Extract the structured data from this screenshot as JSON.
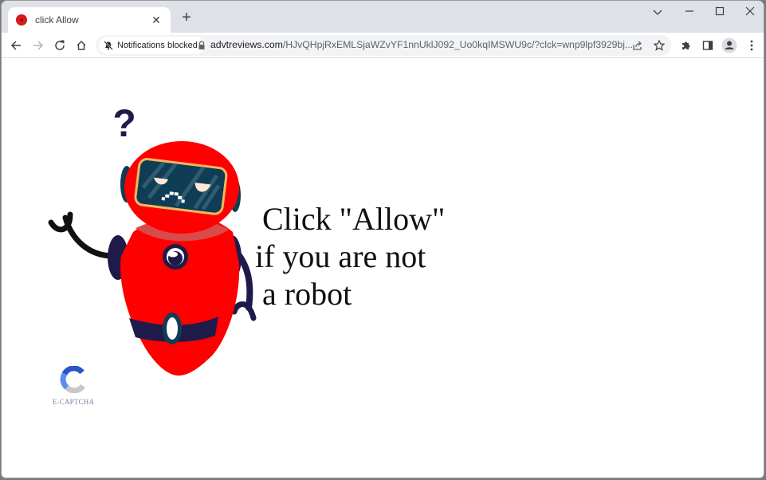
{
  "browser": {
    "tab": {
      "title": "click Allow",
      "favicon": "red-circle-icon",
      "close_label": "✕"
    },
    "new_tab_label": "+",
    "window_controls": {
      "tab_search": "⌄",
      "minimize": "—",
      "maximize": "☐",
      "close": "✕"
    },
    "toolbar": {
      "back": "back-arrow-icon",
      "forward": "forward-arrow-icon",
      "reload": "reload-icon",
      "home": "home-icon",
      "notifications_chip": "Notifications blocked",
      "url_host": "advtreviews.com",
      "url_path": "/HJvQHpjRxEMLSjaWZvYF1nnUklJ092_Uo0kqIMSWU9c/?clck=wnp9lpf3929bj...",
      "share": "share-icon",
      "bookmark": "star-icon",
      "extensions": "puzzle-icon",
      "side_panel": "side-panel-icon",
      "profile": "profile-avatar-icon",
      "menu": "kebab-menu-icon"
    }
  },
  "page": {
    "headline": {
      "line1": "Click \"Allow\"",
      "line2": "if you are not",
      "line3": "a robot"
    },
    "question_mark": "?",
    "logo_label": "E-CAPTCHA",
    "colors": {
      "robot_body": "#ff0000",
      "robot_dark": "#1e1b4b",
      "visor": "#0f3d56",
      "visor_rim": "#f0b860",
      "captcha_blue_dark": "#2a56c6",
      "captcha_blue_light": "#5b8ef0",
      "captcha_gray": "#c7c7c7"
    }
  }
}
